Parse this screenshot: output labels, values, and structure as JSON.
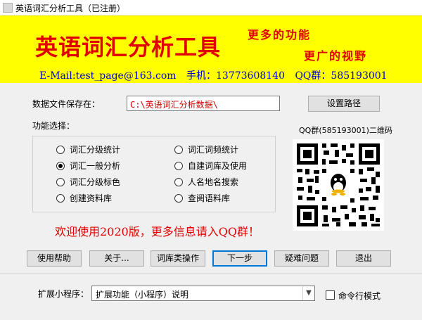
{
  "window": {
    "title": "英语词汇分析工具（已注册）"
  },
  "banner": {
    "main_title": "英语词汇分析工具",
    "slogan1": "更多的功能",
    "slogan2": "更广的视野",
    "email": "E-Mail:test_page@163.com",
    "phone": "手机：13773608140",
    "qq": "QQ群：585193001"
  },
  "storage": {
    "label": "数据文件保存在：",
    "path": "C:\\英语词汇分析数据\\",
    "set_path_button": "设置路径"
  },
  "functions": {
    "label": "功能选择：",
    "left": [
      {
        "label": "词汇分级统计",
        "selected": false
      },
      {
        "label": "词汇一般分析",
        "selected": true
      },
      {
        "label": "词汇分级标色",
        "selected": false
      },
      {
        "label": "创建资料库",
        "selected": false
      }
    ],
    "right": [
      {
        "label": "词汇词频统计",
        "selected": false
      },
      {
        "label": "自建词库及使用",
        "selected": false
      },
      {
        "label": "人名地名搜索",
        "selected": false
      },
      {
        "label": "查阅语料库",
        "selected": false
      }
    ]
  },
  "qrcode": {
    "caption": "QQ群(585193001)二维码",
    "icon": "qq-penguin-icon"
  },
  "welcome": "欢迎使用2020版，更多信息请入QQ群！",
  "buttons": {
    "help": "使用帮助",
    "about": "关于...",
    "lexicon": "词库类操作",
    "next": "下一步",
    "faq": "疑难问题",
    "exit": "退出"
  },
  "extension": {
    "label": "扩展小程序：",
    "selected": "扩展功能（小程序）说明",
    "cmd_mode_label": "命令行模式",
    "cmd_mode_checked": false
  },
  "colors": {
    "banner_bg": "#ffff00",
    "title_red": "#e00000",
    "contact_blue": "#0000c8"
  }
}
